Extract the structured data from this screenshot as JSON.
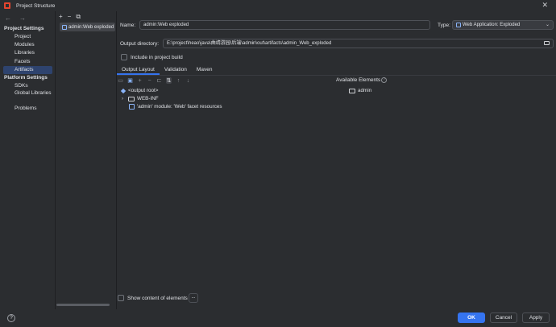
{
  "window": {
    "title": "Project Structure"
  },
  "sidebar": {
    "project_settings_header": "Project Settings",
    "project_items": [
      {
        "label": "Project"
      },
      {
        "label": "Modules"
      },
      {
        "label": "Libraries"
      },
      {
        "label": "Facets"
      },
      {
        "label": "Artifacts",
        "selected": true
      }
    ],
    "platform_settings_header": "Platform Settings",
    "platform_items": [
      {
        "label": "SDKs"
      },
      {
        "label": "Global Libraries"
      }
    ],
    "problems": "Problems"
  },
  "artifacts_list": {
    "items": [
      {
        "label": "admin:Web exploded"
      }
    ]
  },
  "main": {
    "name_label": "Name:",
    "name_value": "admin:Web exploded",
    "type_label": "Type:",
    "type_value": "Web Application: Exploded",
    "output_dir_label": "Output directory:",
    "output_dir_value": "E:\\project\\heao\\java\\曲靖游园\\后端\\admin\\out\\artifacts\\admin_Web_exploded",
    "include_in_build_label": "Include in project build",
    "include_in_build_checked": false,
    "tabs": [
      {
        "label": "Output Layout",
        "active": true
      },
      {
        "label": "Validation"
      },
      {
        "label": "Maven"
      }
    ],
    "available_elements_label": "Available Elements",
    "tree": [
      {
        "label": "<output root>"
      },
      {
        "label": "WEB-INF"
      },
      {
        "label": "'admin' module: 'Web' facet resources"
      }
    ],
    "available_tree": [
      {
        "label": "admin"
      }
    ],
    "show_content_label": "Show content of elements",
    "show_content_checked": false,
    "ellipsis_button": "..."
  },
  "footer": {
    "help": "?",
    "ok": "OK",
    "cancel": "Cancel",
    "apply": "Apply"
  },
  "colors": {
    "background": "#2b2d30",
    "selection": "#2e436e",
    "accent": "#3574f0"
  }
}
